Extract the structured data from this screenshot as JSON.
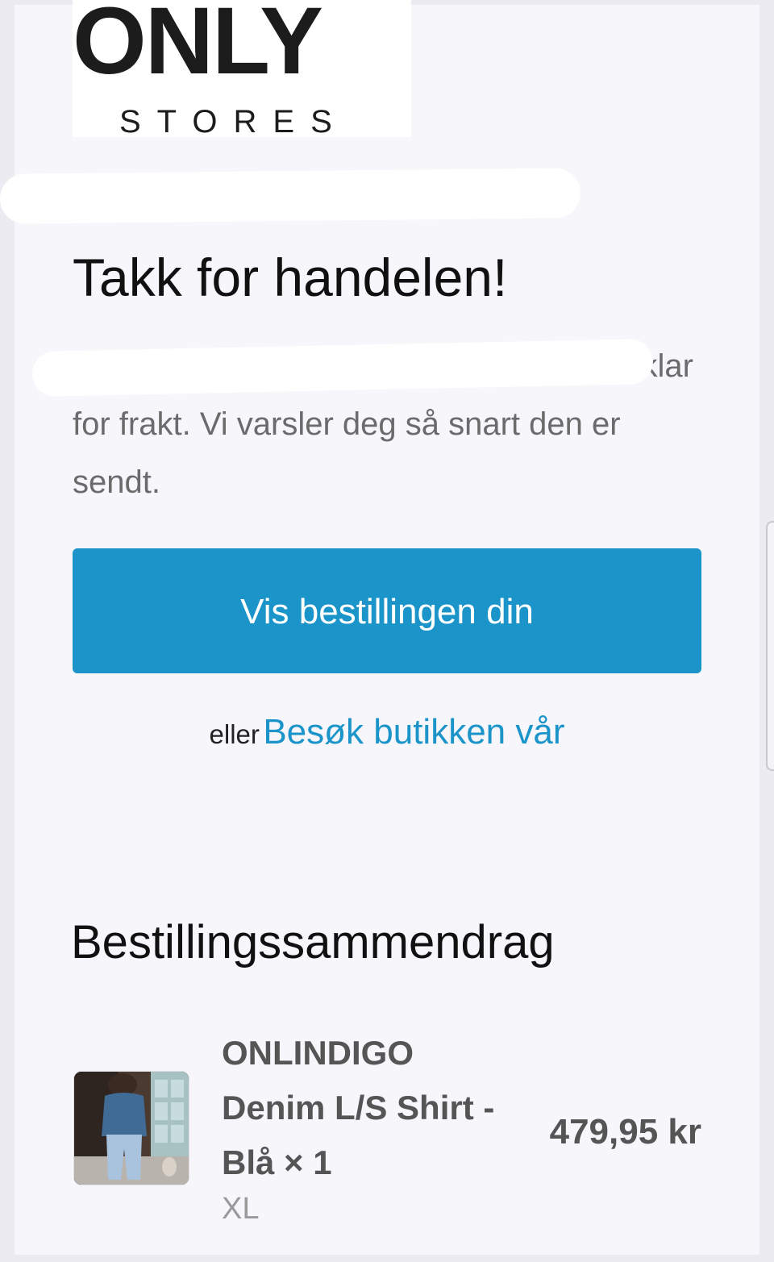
{
  "brand": {
    "logo_main": "ONLY",
    "logo_sub": "STORES"
  },
  "confirmation": {
    "heading": "Takk for handelen!",
    "message_visible_end": "klar",
    "message_rest": "for frakt. Vi varsler deg så snart den er sendt."
  },
  "actions": {
    "primary_button_label": "Vis bestillingen din",
    "alternative_prefix": "eller",
    "alternative_link_label": "Besøk butikken vår",
    "primary_button_color": "#1b94c9",
    "link_color": "#1b94c9"
  },
  "order_summary": {
    "title": "Bestillingssammendrag",
    "items": [
      {
        "name": "ONLINDIGO Denim L/S Shirt - Blå × 1",
        "variant": "XL",
        "price": "479,95 kr"
      }
    ]
  }
}
